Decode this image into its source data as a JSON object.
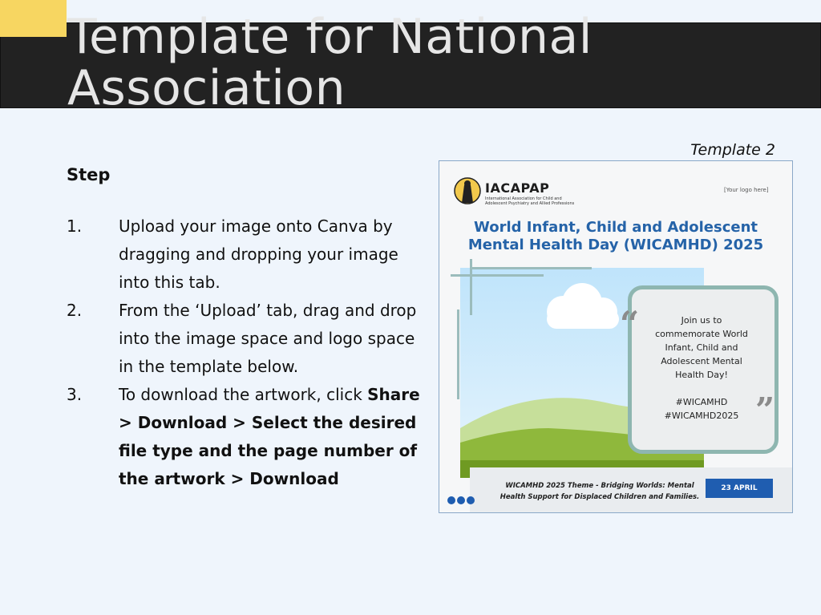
{
  "slide": {
    "title": "Template for National Association",
    "template_caption": "Template 2",
    "step_heading": "Step"
  },
  "steps": [
    {
      "num": "1.",
      "text": "Upload your image onto Canva by dragging and dropping your image into this tab."
    },
    {
      "num": "2.",
      "text": "From the ‘Upload’ tab, drag and drop into the image space and logo space in the template below."
    },
    {
      "num": "3.",
      "text_prefix": "To download the artwork, click ",
      "text_bold": "Share > Download > Select the desired file type and the page number of the artwork > Download"
    }
  ],
  "poster": {
    "logo_name": "IACAPAP",
    "logo_subtitle": "International Association for Child and Adolescent Psychiatry and Allied Professions",
    "your_logo": "[Your logo here]",
    "title": "World Infant, Child and Adolescent Mental Health Day (WICAMHD) 2025",
    "quote_open": "“",
    "quote_close": "”",
    "quote_lines": [
      "Join us to",
      "commemorate World",
      "Infant, Child and",
      "Adolescent Mental",
      "Health Day!",
      "",
      "#WICAMHD",
      "#WICAMHD2025"
    ],
    "theme": "WICAMHD 2025 Theme - Bridging Worlds: Mental Health Support for Displaced Children and Families.",
    "date": "23 APRIL"
  },
  "colors": {
    "background": "#eff5fc",
    "title_bar": "#222222",
    "accent": "#f7d661",
    "poster_blue": "#1f5db0"
  }
}
